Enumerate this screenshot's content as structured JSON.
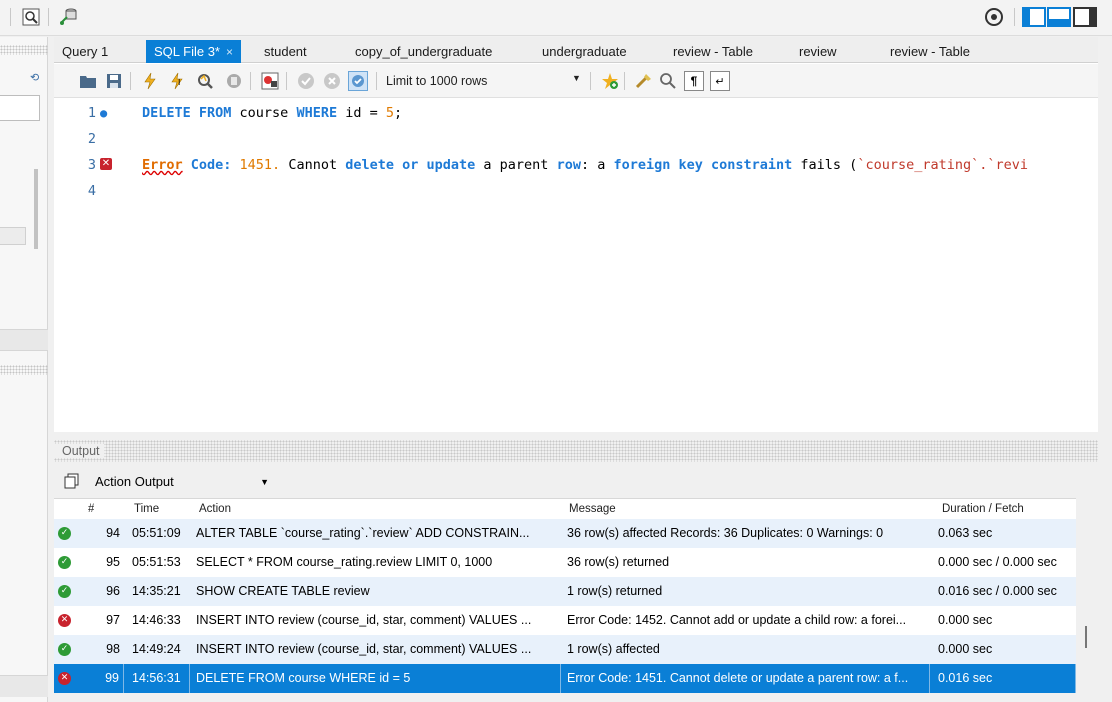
{
  "tabs": [
    {
      "label": "Query 1"
    },
    {
      "label": "SQL File 3*",
      "close": "×"
    },
    {
      "label": "student"
    },
    {
      "label": "copy_of_undergraduate"
    },
    {
      "label": "undergraduate"
    },
    {
      "label": "review - Table"
    },
    {
      "label": "review"
    },
    {
      "label": "review - Table"
    }
  ],
  "toolbar": {
    "limit_label": "Limit to 1000 rows"
  },
  "editor": {
    "lines": [
      {
        "num": "1"
      },
      {
        "num": "2"
      },
      {
        "num": "3"
      },
      {
        "num": "4"
      }
    ],
    "line1": {
      "kw1": "DELETE FROM",
      "t1": " course ",
      "kw2": "WHERE",
      "t2": " id = ",
      "num": "5",
      "t3": ";"
    },
    "line3": {
      "err": "Error",
      "kw1": " Code:",
      "code": " 1451.",
      "t1": " Cannot ",
      "kw2": "delete or update",
      "t2": " a parent ",
      "kw3": "row",
      "t3": ": a ",
      "kw4": "foreign key constraint",
      "t4": " fails (",
      "s1": "`course_rating`.`revi"
    }
  },
  "output": {
    "title": "Output",
    "selector": "Action Output",
    "columns": {
      "num": "#",
      "time": "Time",
      "action": "Action",
      "message": "Message",
      "duration": "Duration / Fetch"
    },
    "rows": [
      {
        "status": "ok",
        "num": "94",
        "time": "05:51:09",
        "action": "ALTER TABLE `course_rating`.`review`  ADD CONSTRAIN...",
        "message": "36 row(s) affected Records: 36  Duplicates: 0  Warnings: 0",
        "duration": "0.063 sec"
      },
      {
        "status": "ok",
        "num": "95",
        "time": "05:51:53",
        "action": "SELECT * FROM course_rating.review LIMIT 0, 1000",
        "message": "36 row(s) returned",
        "duration": "0.000 sec / 0.000 sec"
      },
      {
        "status": "ok",
        "num": "96",
        "time": "14:35:21",
        "action": "SHOW CREATE TABLE review",
        "message": "1 row(s) returned",
        "duration": "0.016 sec / 0.000 sec"
      },
      {
        "status": "error",
        "num": "97",
        "time": "14:46:33",
        "action": "INSERT INTO review (course_id, star, comment) VALUES ...",
        "message": "Error Code: 1452. Cannot add or update a child row: a forei...",
        "duration": "0.000 sec"
      },
      {
        "status": "ok",
        "num": "98",
        "time": "14:49:24",
        "action": "INSERT INTO review (course_id, star, comment) VALUES ...",
        "message": "1 row(s) affected",
        "duration": "0.000 sec"
      },
      {
        "status": "error",
        "num": "99",
        "time": "14:56:31",
        "action": "DELETE FROM course WHERE id = 5",
        "message": "Error Code: 1451. Cannot delete or update a parent row: a f...",
        "duration": "0.016 sec"
      }
    ]
  },
  "colors": {
    "accent": "#0a7fd6",
    "ok": "#2e9b36",
    "error": "#c8232d",
    "keyword": "#1e7ad6"
  }
}
